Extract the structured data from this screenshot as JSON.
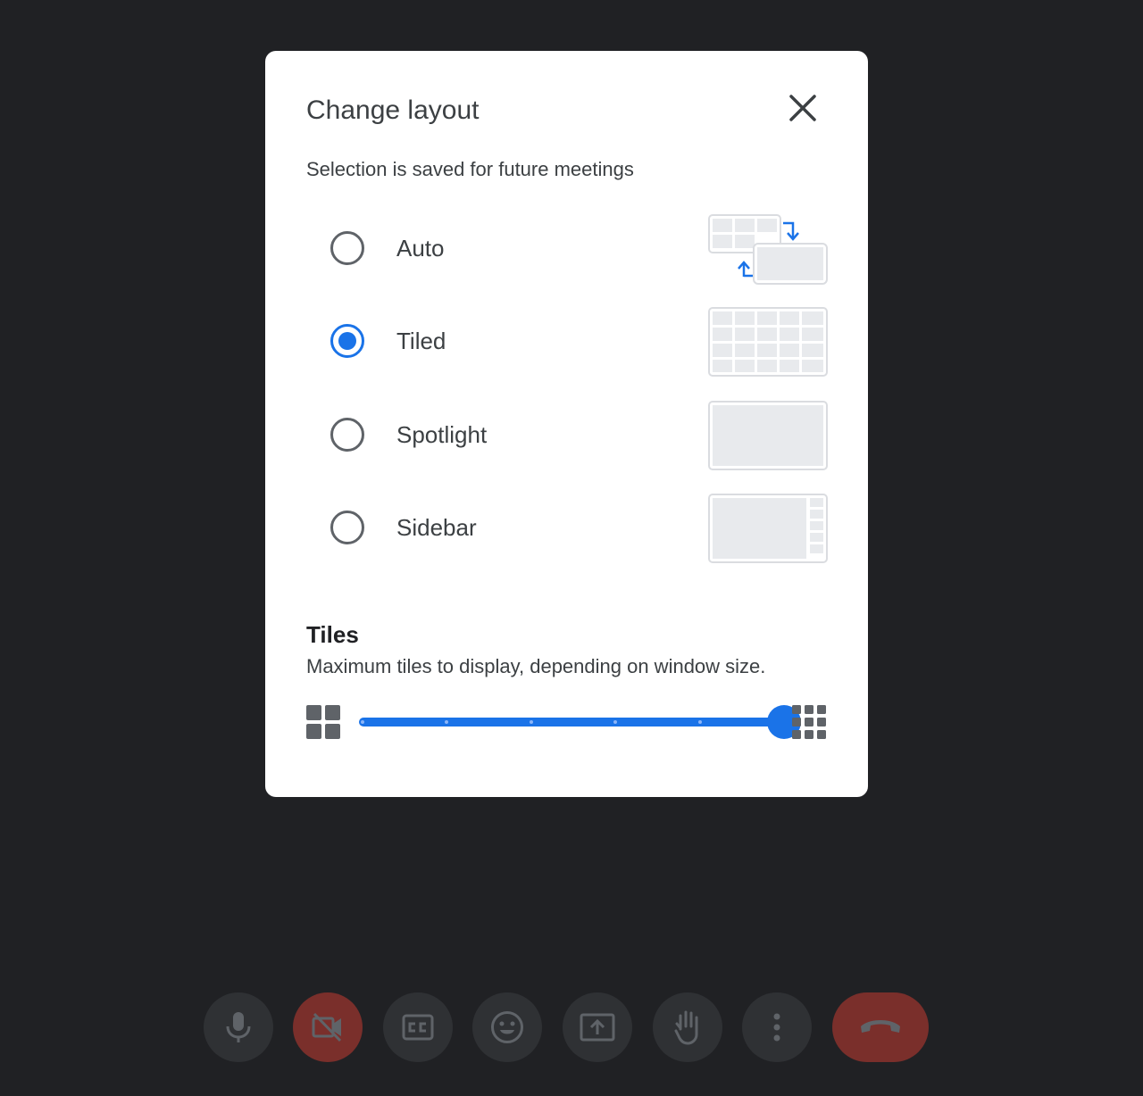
{
  "dialog": {
    "title": "Change layout",
    "subtitle": "Selection is saved for future meetings",
    "options": [
      {
        "label": "Auto",
        "checked": false
      },
      {
        "label": "Tiled",
        "checked": true
      },
      {
        "label": "Spotlight",
        "checked": false
      },
      {
        "label": "Sidebar",
        "checked": false
      }
    ],
    "tiles": {
      "title": "Tiles",
      "description": "Maximum tiles to display, depending on window size.",
      "slider": {
        "steps": 6,
        "selected_step": 6,
        "value_fraction": 1.0
      }
    }
  },
  "toolbar": {
    "buttons": [
      {
        "icon": "mic-icon",
        "state": "on"
      },
      {
        "icon": "camera-off-icon",
        "state": "off"
      },
      {
        "icon": "captions-icon",
        "state": "off"
      },
      {
        "icon": "emoji-icon",
        "state": "off"
      },
      {
        "icon": "present-screen-icon",
        "state": "off"
      },
      {
        "icon": "raise-hand-icon",
        "state": "off"
      },
      {
        "icon": "more-options-icon",
        "state": "off"
      },
      {
        "icon": "leave-call-icon",
        "state": "leave"
      }
    ]
  },
  "colors": {
    "background": "#202124",
    "accent": "#1a73e8",
    "leave": "#7a2f2b",
    "button": "#2f3134"
  }
}
